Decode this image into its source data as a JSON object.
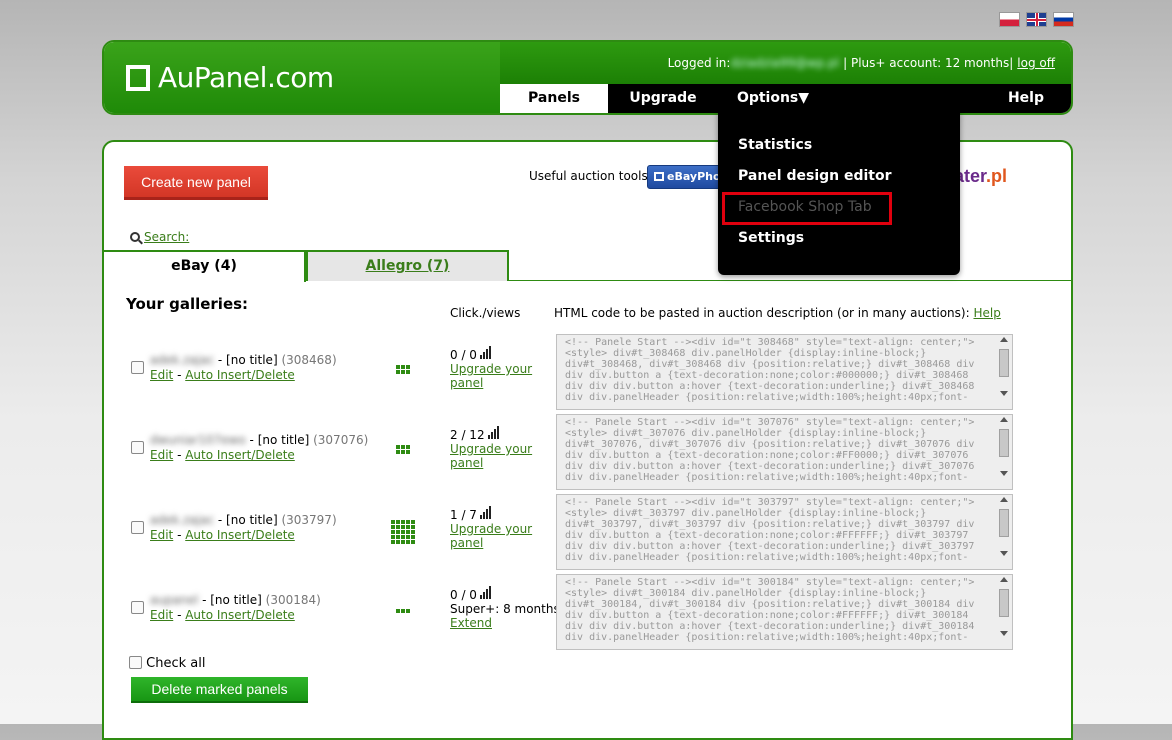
{
  "flags": [
    "Polish",
    "English",
    "Russian"
  ],
  "logo": {
    "text": "AuPanel.com"
  },
  "header": {
    "logged_in_label": "Logged in:",
    "logged_in_user": "dziadzia99@wp.pl",
    "account": "| Plus+ account: 12 months|",
    "logout": "log off"
  },
  "nav": {
    "panels": "Panels",
    "upgrade": "Upgrade",
    "options": "Options▼",
    "help": "Help"
  },
  "dropdown": {
    "items": [
      {
        "label": "Statistics"
      },
      {
        "label": "Panel design editor"
      },
      {
        "label": "Facebook Shop Tab"
      },
      {
        "label": "Settings"
      }
    ]
  },
  "toolbar": {
    "create_label": "Create new panel",
    "tools_label": "Useful auction tools:",
    "ebayphoto_label": "eBayPhoto",
    "partner_logo_main": "ater",
    "partner_logo_suffix": ".pl",
    "search_label": "Search:"
  },
  "tabs": {
    "ebay": "eBay (4)",
    "allegro": "Allegro (7)"
  },
  "galleries": {
    "title": "Your galleries:",
    "col_click": "Click./views",
    "col_html": "HTML code to be pasted in auction description (or in many auctions):",
    "col_help": "Help",
    "edit_label": "Edit",
    "sep": " - ",
    "auto_label": "Auto Insert/Delete",
    "rows": [
      {
        "user": "adek.zajac",
        "title": "- [no title]",
        "id": "(308468)",
        "stats": "0 / 0",
        "link1": "Upgrade your",
        "link2": "panel",
        "code": "<!-- Panele Start --><div id=\"t 308468\" style=\"text-align: center;\"><style> div#t_308468 div.panelHolder {display:inline-block;} div#t_308468, div#t_308468 div {position:relative;} div#t_308468 div div div.button a {text-decoration:none;color:#000000;} div#t_308468 div div div.button a:hover {text-decoration:underline;} div#t_308468 div div.panelHeader {position:relative;width:100%;height:40px;font-"
      },
      {
        "user": "dwuniar107ewo",
        "title": "- [no title]",
        "id": "(307076)",
        "stats": "2 / 12",
        "link1": "Upgrade your",
        "link2": "panel",
        "code": "<!-- Panele Start --><div id=\"t 307076\" style=\"text-align: center;\"><style> div#t_307076 div.panelHolder {display:inline-block;} div#t_307076, div#t_307076 div {position:relative;} div#t_307076 div div div.button a {text-decoration:none;color:#FF0000;} div#t_307076 div div div.button a:hover {text-decoration:underline;} div#t_307076 div div.panelHeader {position:relative;width:100%;height:40px;font-"
      },
      {
        "user": "adek.zajac",
        "title": "- [no title]",
        "id": "(303797)",
        "stats": "1 / 7",
        "link1": "Upgrade your",
        "link2": "panel",
        "code": "<!-- Panele Start --><div id=\"t 303797\" style=\"text-align: center;\"><style> div#t_303797 div.panelHolder {display:inline-block;} div#t_303797, div#t_303797 div {position:relative;} div#t_303797 div div div.button a {text-decoration:none;color:#FFFFFF;} div#t_303797 div div div.button a:hover {text-decoration:underline;} div#t_303797 div div.panelHeader {position:relative;width:100%;height:40px;font-"
      },
      {
        "user": "aupanel",
        "title": "- [no title]",
        "id": "(300184)",
        "stats": "0 / 0",
        "link1": "Super+: 8 months",
        "link2": "Extend",
        "code": "<!-- Panele Start --><div id=\"t 300184\" style=\"text-align: center;\"><style> div#t_300184 div.panelHolder {display:inline-block;} div#t_300184, div#t_300184 div {position:relative;} div#t_300184 div div div.button a {text-decoration:none;color:#FFFFFF;} div#t_300184 div div div.button a:hover {text-decoration:underline;} div#t_300184 div div.panelHeader {position:relative;width:100%;height:40px;font-"
      }
    ]
  },
  "footer": {
    "check_all": "Check all",
    "delete_label": "Delete marked panels"
  },
  "colors": {
    "brand_green": "#2e8b12",
    "create_red": "#d33626",
    "highlight": "#e0000e"
  }
}
